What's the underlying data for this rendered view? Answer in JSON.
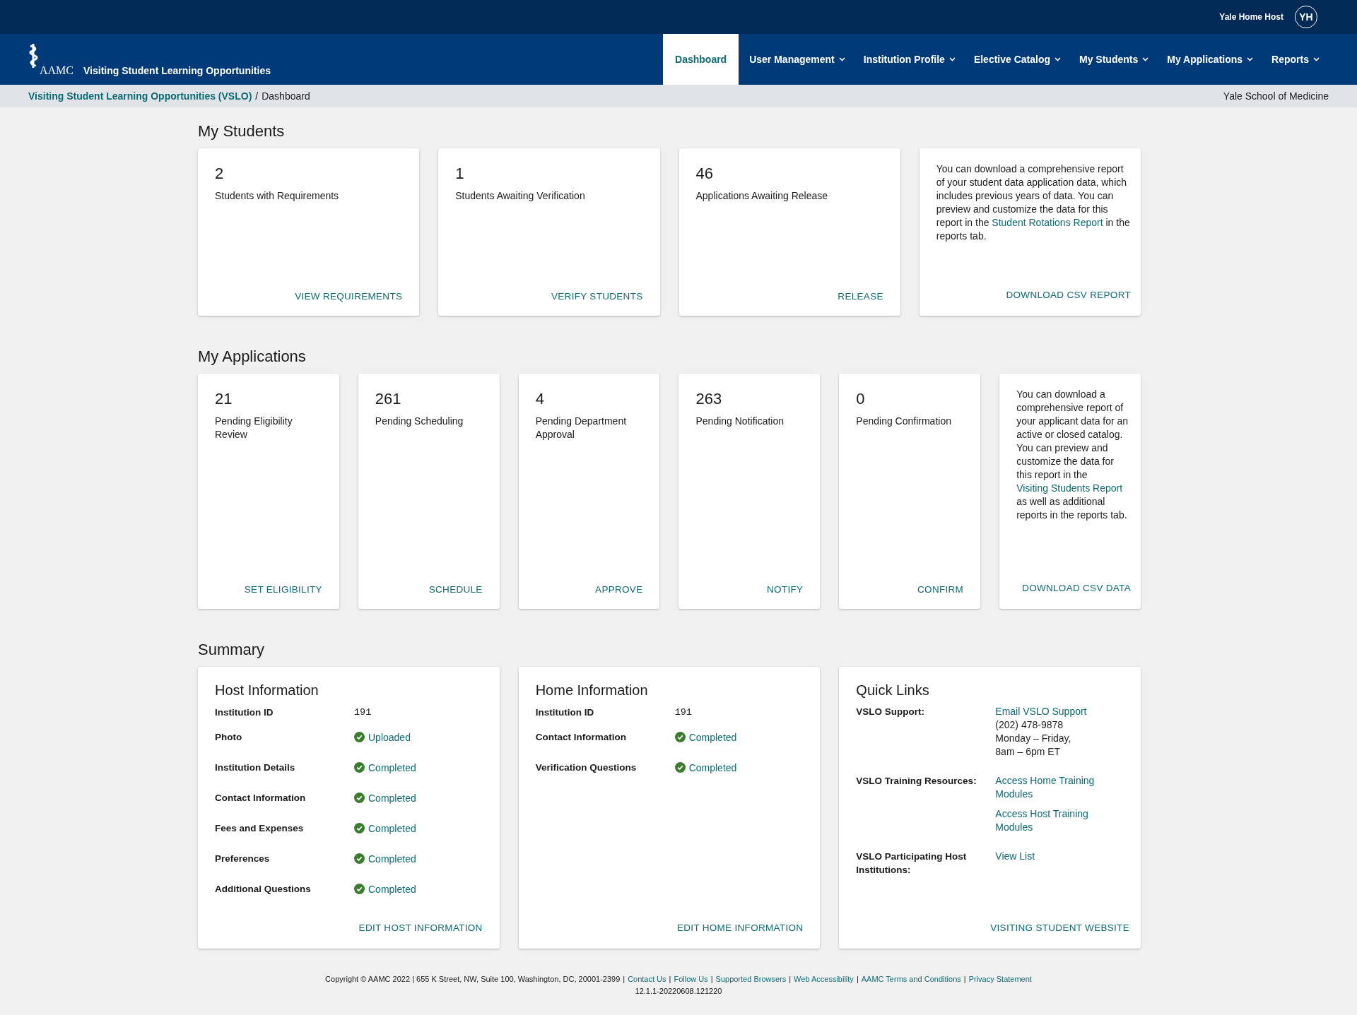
{
  "top_bar": {
    "user_name": "Yale Home Host",
    "avatar_initials": "YH"
  },
  "header": {
    "logo_text": "AAMC",
    "app_title": "Visiting Student Learning Opportunities"
  },
  "nav": [
    {
      "label": "Dashboard",
      "selected": true,
      "dropdown": false
    },
    {
      "label": "User Management",
      "selected": false,
      "dropdown": true
    },
    {
      "label": "Institution Profile",
      "selected": false,
      "dropdown": true
    },
    {
      "label": "Elective Catalog",
      "selected": false,
      "dropdown": true
    },
    {
      "label": "My Students",
      "selected": false,
      "dropdown": true
    },
    {
      "label": "My Applications",
      "selected": false,
      "dropdown": true
    },
    {
      "label": "Reports",
      "selected": false,
      "dropdown": true
    }
  ],
  "breadcrumb": {
    "items": [
      "Visiting Student Learning Opportunities (VSLO)",
      "Dashboard"
    ],
    "separator": "/",
    "institution": "Yale School of Medicine"
  },
  "my_students": {
    "title": "My Students",
    "cards": [
      {
        "count": "2",
        "label": "Students with Requirements",
        "action": "VIEW REQUIREMENTS"
      },
      {
        "count": "1",
        "label": "Students Awaiting Verification",
        "action": "VERIFY STUDENTS"
      },
      {
        "count": "46",
        "label": "Applications Awaiting Release",
        "action": "RELEASE"
      }
    ],
    "report": {
      "parts": [
        {
          "kind": "text",
          "text": "You can download a comprehensive report of your student data application data, which includes previous years of data. You can preview and customize the data for this report in the "
        },
        {
          "kind": "link",
          "text": "Student Rotations Report"
        },
        {
          "kind": "text",
          "text": " in the reports tab."
        }
      ],
      "action": "DOWNLOAD CSV REPORT"
    }
  },
  "my_applications": {
    "title": "My Applications",
    "cards": [
      {
        "count": "21",
        "label": "Pending Eligibility Review",
        "action": "SET ELIGIBILITY"
      },
      {
        "count": "261",
        "label": "Pending Scheduling",
        "action": "SCHEDULE"
      },
      {
        "count": "4",
        "label": "Pending Department Approval",
        "action": "APPROVE"
      },
      {
        "count": "263",
        "label": "Pending Notification",
        "action": "NOTIFY"
      },
      {
        "count": "0",
        "label": "Pending Confirmation",
        "action": "CONFIRM"
      }
    ],
    "report": {
      "parts": [
        {
          "kind": "text",
          "text": "You can download a comprehensive report of your applicant data for an active or closed catalog. You can preview and customize the data for this report in the "
        },
        {
          "kind": "link",
          "text": "Visiting Students Report"
        },
        {
          "kind": "text",
          "text": " as well as additional reports in the reports tab."
        }
      ],
      "action": "DOWNLOAD CSV DATA"
    }
  },
  "summary": {
    "title": "Summary",
    "host_information": {
      "title": "Host Information",
      "rows": [
        {
          "label": "Institution ID",
          "kind": "text",
          "value": "191"
        },
        {
          "label": "Photo",
          "kind": "status",
          "value": "Uploaded"
        },
        {
          "label": "Institution Details",
          "kind": "status",
          "value": "Completed"
        },
        {
          "label": "Contact Information",
          "kind": "status",
          "value": "Completed"
        },
        {
          "label": "Fees and Expenses",
          "kind": "status",
          "value": "Completed"
        },
        {
          "label": "Preferences",
          "kind": "status",
          "value": "Completed"
        },
        {
          "label": "Additional Questions",
          "kind": "status",
          "value": "Completed"
        }
      ],
      "action": "EDIT HOST INFORMATION"
    },
    "home_information": {
      "title": "Home Information",
      "rows": [
        {
          "label": "Institution ID",
          "kind": "text",
          "value": "191"
        },
        {
          "label": "Contact Information",
          "kind": "status",
          "value": "Completed"
        },
        {
          "label": "Verification Questions",
          "kind": "status",
          "value": "Completed"
        }
      ],
      "action": "EDIT HOME INFORMATION"
    },
    "quick_links": {
      "title": "Quick Links",
      "rows": [
        {
          "label": "VSLO Support:",
          "values": [
            {
              "kind": "link",
              "text": "Email VSLO Support"
            },
            {
              "kind": "text",
              "text": "(202) 478-9878"
            },
            {
              "kind": "text",
              "text": "Monday – Friday,"
            },
            {
              "kind": "text",
              "text": "8am – 6pm ET"
            }
          ]
        },
        {
          "label": "VSLO Training Resources:",
          "values": [
            {
              "kind": "link",
              "text": "Access Home Training Modules"
            },
            {
              "kind": "link",
              "text": "Access Host Training Modules"
            }
          ]
        },
        {
          "label": "VSLO Participating Host Institutions:",
          "values": [
            {
              "kind": "link",
              "text": "View List"
            }
          ]
        }
      ],
      "action": "VISITING STUDENT WEBSITE"
    }
  },
  "footer": {
    "copyright": "Copyright © AAMC 2022 | 655 K Street, NW, Suite 100, Washington, DC, 20001-2399",
    "links": [
      "Contact Us",
      "Follow Us",
      "Supported Browsers",
      "Web Accessibility",
      "AAMC Terms and Conditions",
      "Privacy Statement"
    ],
    "separator": "|",
    "version": "12.1.1-20220608.121220"
  }
}
